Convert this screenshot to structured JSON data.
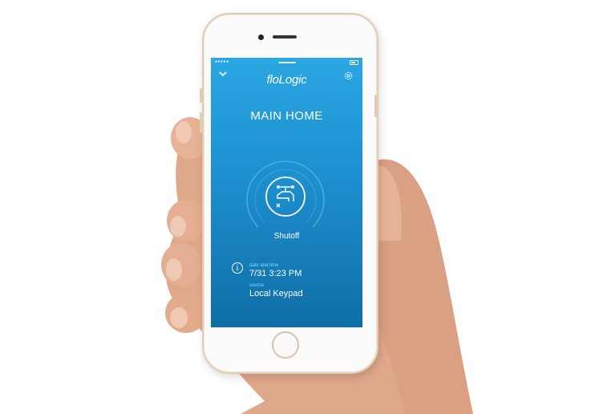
{
  "app": {
    "logo": "floLogic",
    "title": "MAIN HOME"
  },
  "status_bar": {
    "signal": "●●●●●"
  },
  "icons": {
    "back": "chevron-down-icon",
    "settings": "gear-icon",
    "valve": "faucet-shutoff-icon",
    "info": "info-icon"
  },
  "valve": {
    "state_label": "Shutoff"
  },
  "event": {
    "info_glyph": "i",
    "datetime_label": "date and time",
    "datetime_value": "7/31 3:23 PM",
    "source_label": "source",
    "source_value": "Local Keypad"
  },
  "colors": {
    "screen_top": "#2aa7e2",
    "screen_bottom": "#0f6ea6",
    "label_accent": "#8fd6fb"
  }
}
